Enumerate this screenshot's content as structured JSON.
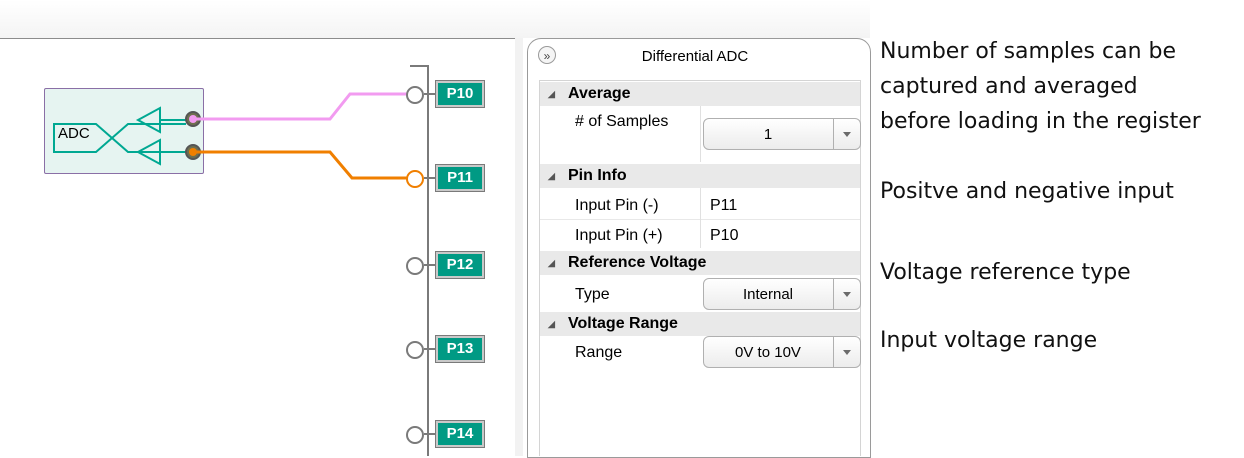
{
  "canvas": {
    "adc_block_label": "ADC",
    "pins": [
      {
        "label": "P10"
      },
      {
        "label": "P11"
      },
      {
        "label": "P12"
      },
      {
        "label": "P13"
      },
      {
        "label": "P14"
      }
    ],
    "wire_colors": {
      "positive": "#f29bf0",
      "negative": "#f07f00",
      "block_teal": "#00a892"
    }
  },
  "panel": {
    "title": "Differential ADC",
    "collapse_icon": "»",
    "groups": [
      {
        "name": "Average",
        "properties": [
          {
            "name": "# of Samples",
            "value": "1",
            "control": "dropdown"
          }
        ]
      },
      {
        "name": "Pin Info",
        "properties": [
          {
            "name": "Input Pin (-)",
            "value": "P11"
          },
          {
            "name": "Input Pin (+)",
            "value": "P10"
          }
        ]
      },
      {
        "name": "Reference Voltage",
        "properties": [
          {
            "name": "Type",
            "value": "Internal",
            "control": "dropdown"
          }
        ]
      },
      {
        "name": "Voltage Range",
        "properties": [
          {
            "name": "Range",
            "value": "0V to 10V",
            "control": "dropdown"
          }
        ]
      }
    ]
  },
  "annotations": {
    "samples_line1": "Number of samples can be",
    "samples_line2": "captured and averaged",
    "samples_line3": "before loading in the register",
    "pins": "Positve and negative input",
    "reference": "Voltage reference type",
    "range": "Input voltage range"
  }
}
